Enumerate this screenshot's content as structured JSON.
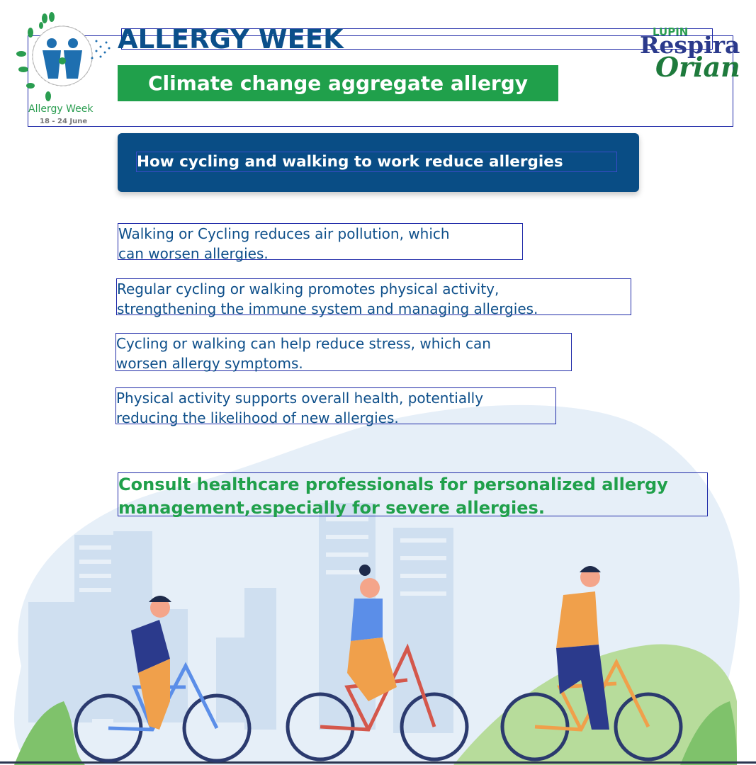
{
  "header": {
    "title": "ALLERGY WEEK",
    "subtitle": "Climate change aggregate allergy"
  },
  "allergy_week_logo": {
    "label": "Allergy Week",
    "dates": "18 - 24 June"
  },
  "brand_logo": {
    "top": "LUPIN",
    "middle": "Respira",
    "bottom": "Orian"
  },
  "banner": {
    "text": "How cycling and walking to work reduce allergies"
  },
  "points": [
    {
      "line1": "Walking or Cycling reduces air pollution, which",
      "line2": "can worsen allergies."
    },
    {
      "line1": "Regular cycling or walking promotes physical activity,",
      "line2": "strengthening the immune system and managing allergies."
    },
    {
      "line1": "Cycling or walking can help reduce stress, which can",
      "line2": "worsen allergy symptoms."
    },
    {
      "line1": "Physical activity supports overall health, potentially",
      "line2": "reducing the likelihood of new allergies."
    }
  ],
  "consult": {
    "line1": "Consult healthcare professionals for personalized allergy",
    "line2": "management,especially for severe allergies."
  },
  "illustration": {
    "subject": "three-cyclists-city",
    "colors": {
      "blue": "#0b4f8a",
      "green": "#20a04b",
      "sky": "#dce9f5",
      "grass": "#b7dc9b"
    }
  }
}
